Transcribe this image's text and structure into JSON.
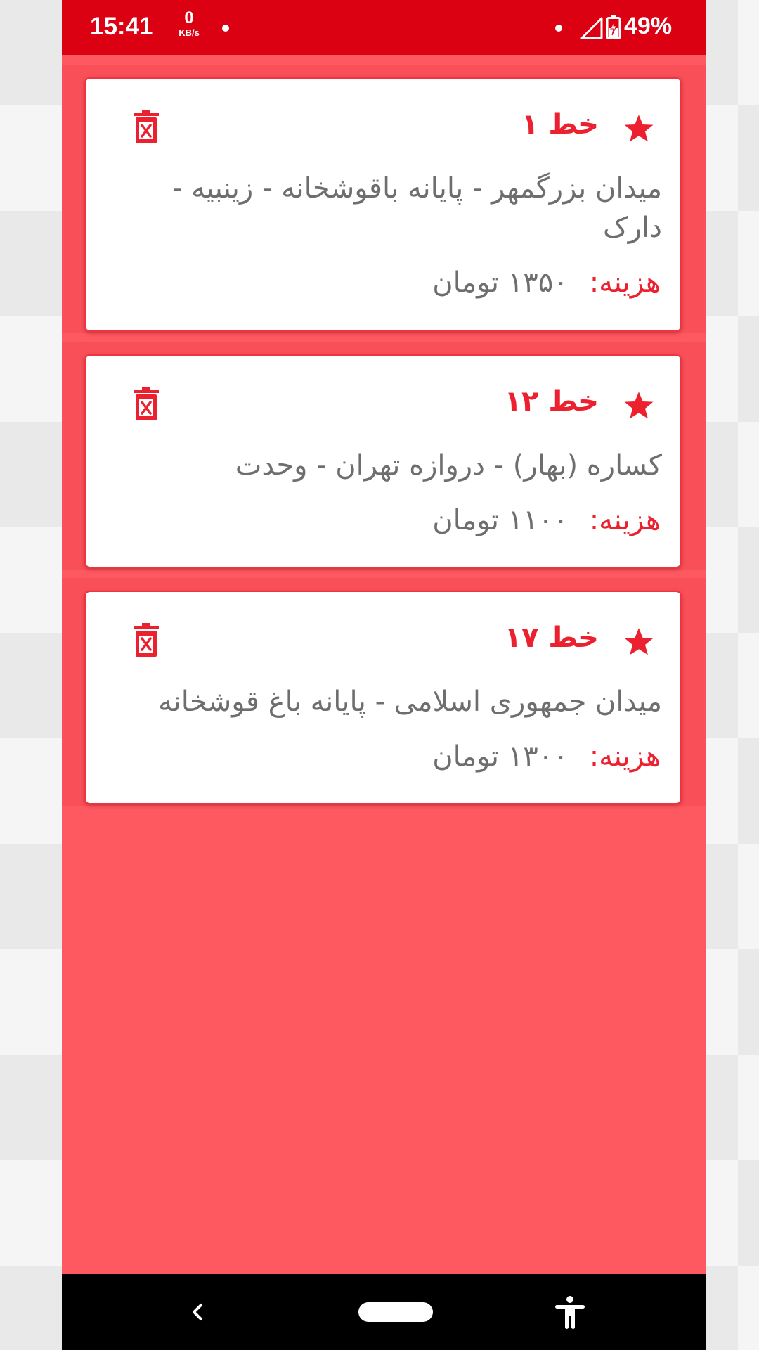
{
  "status_bar": {
    "time": "15:41",
    "net_speed_value": "0",
    "net_speed_unit": "KB/s",
    "battery_percent": "49%"
  },
  "favorites": [
    {
      "line": "خط ۱",
      "route": "میدان بزرگمهر - پایانه باقوشخانه - زینبیه - دارک",
      "cost_label": "هزینه:",
      "cost_value": "۱۳۵۰ تومان"
    },
    {
      "line": "خط ۱۲",
      "route": "کساره (بهار) - دروازه تهران - وحدت",
      "cost_label": "هزینه:",
      "cost_value": "۱۱۰۰ تومان"
    },
    {
      "line": "خط ۱۷",
      "route": "میدان جمهوری اسلامی - پایانه باغ قوشخانه",
      "cost_label": "هزینه:",
      "cost_value": "۱۳۰۰ تومان"
    }
  ],
  "icons": {
    "favorite": "star-icon",
    "delete": "trash-icon",
    "back": "chevron-left-icon",
    "home": "home-pill-icon",
    "accessibility": "accessibility-icon"
  },
  "colors": {
    "status_bar": "#db0012",
    "app_background": "#fe5861",
    "accent": "#ec2130",
    "body_text": "#6e6e6e",
    "card": "#ffffff",
    "nav_bar": "#000000"
  }
}
